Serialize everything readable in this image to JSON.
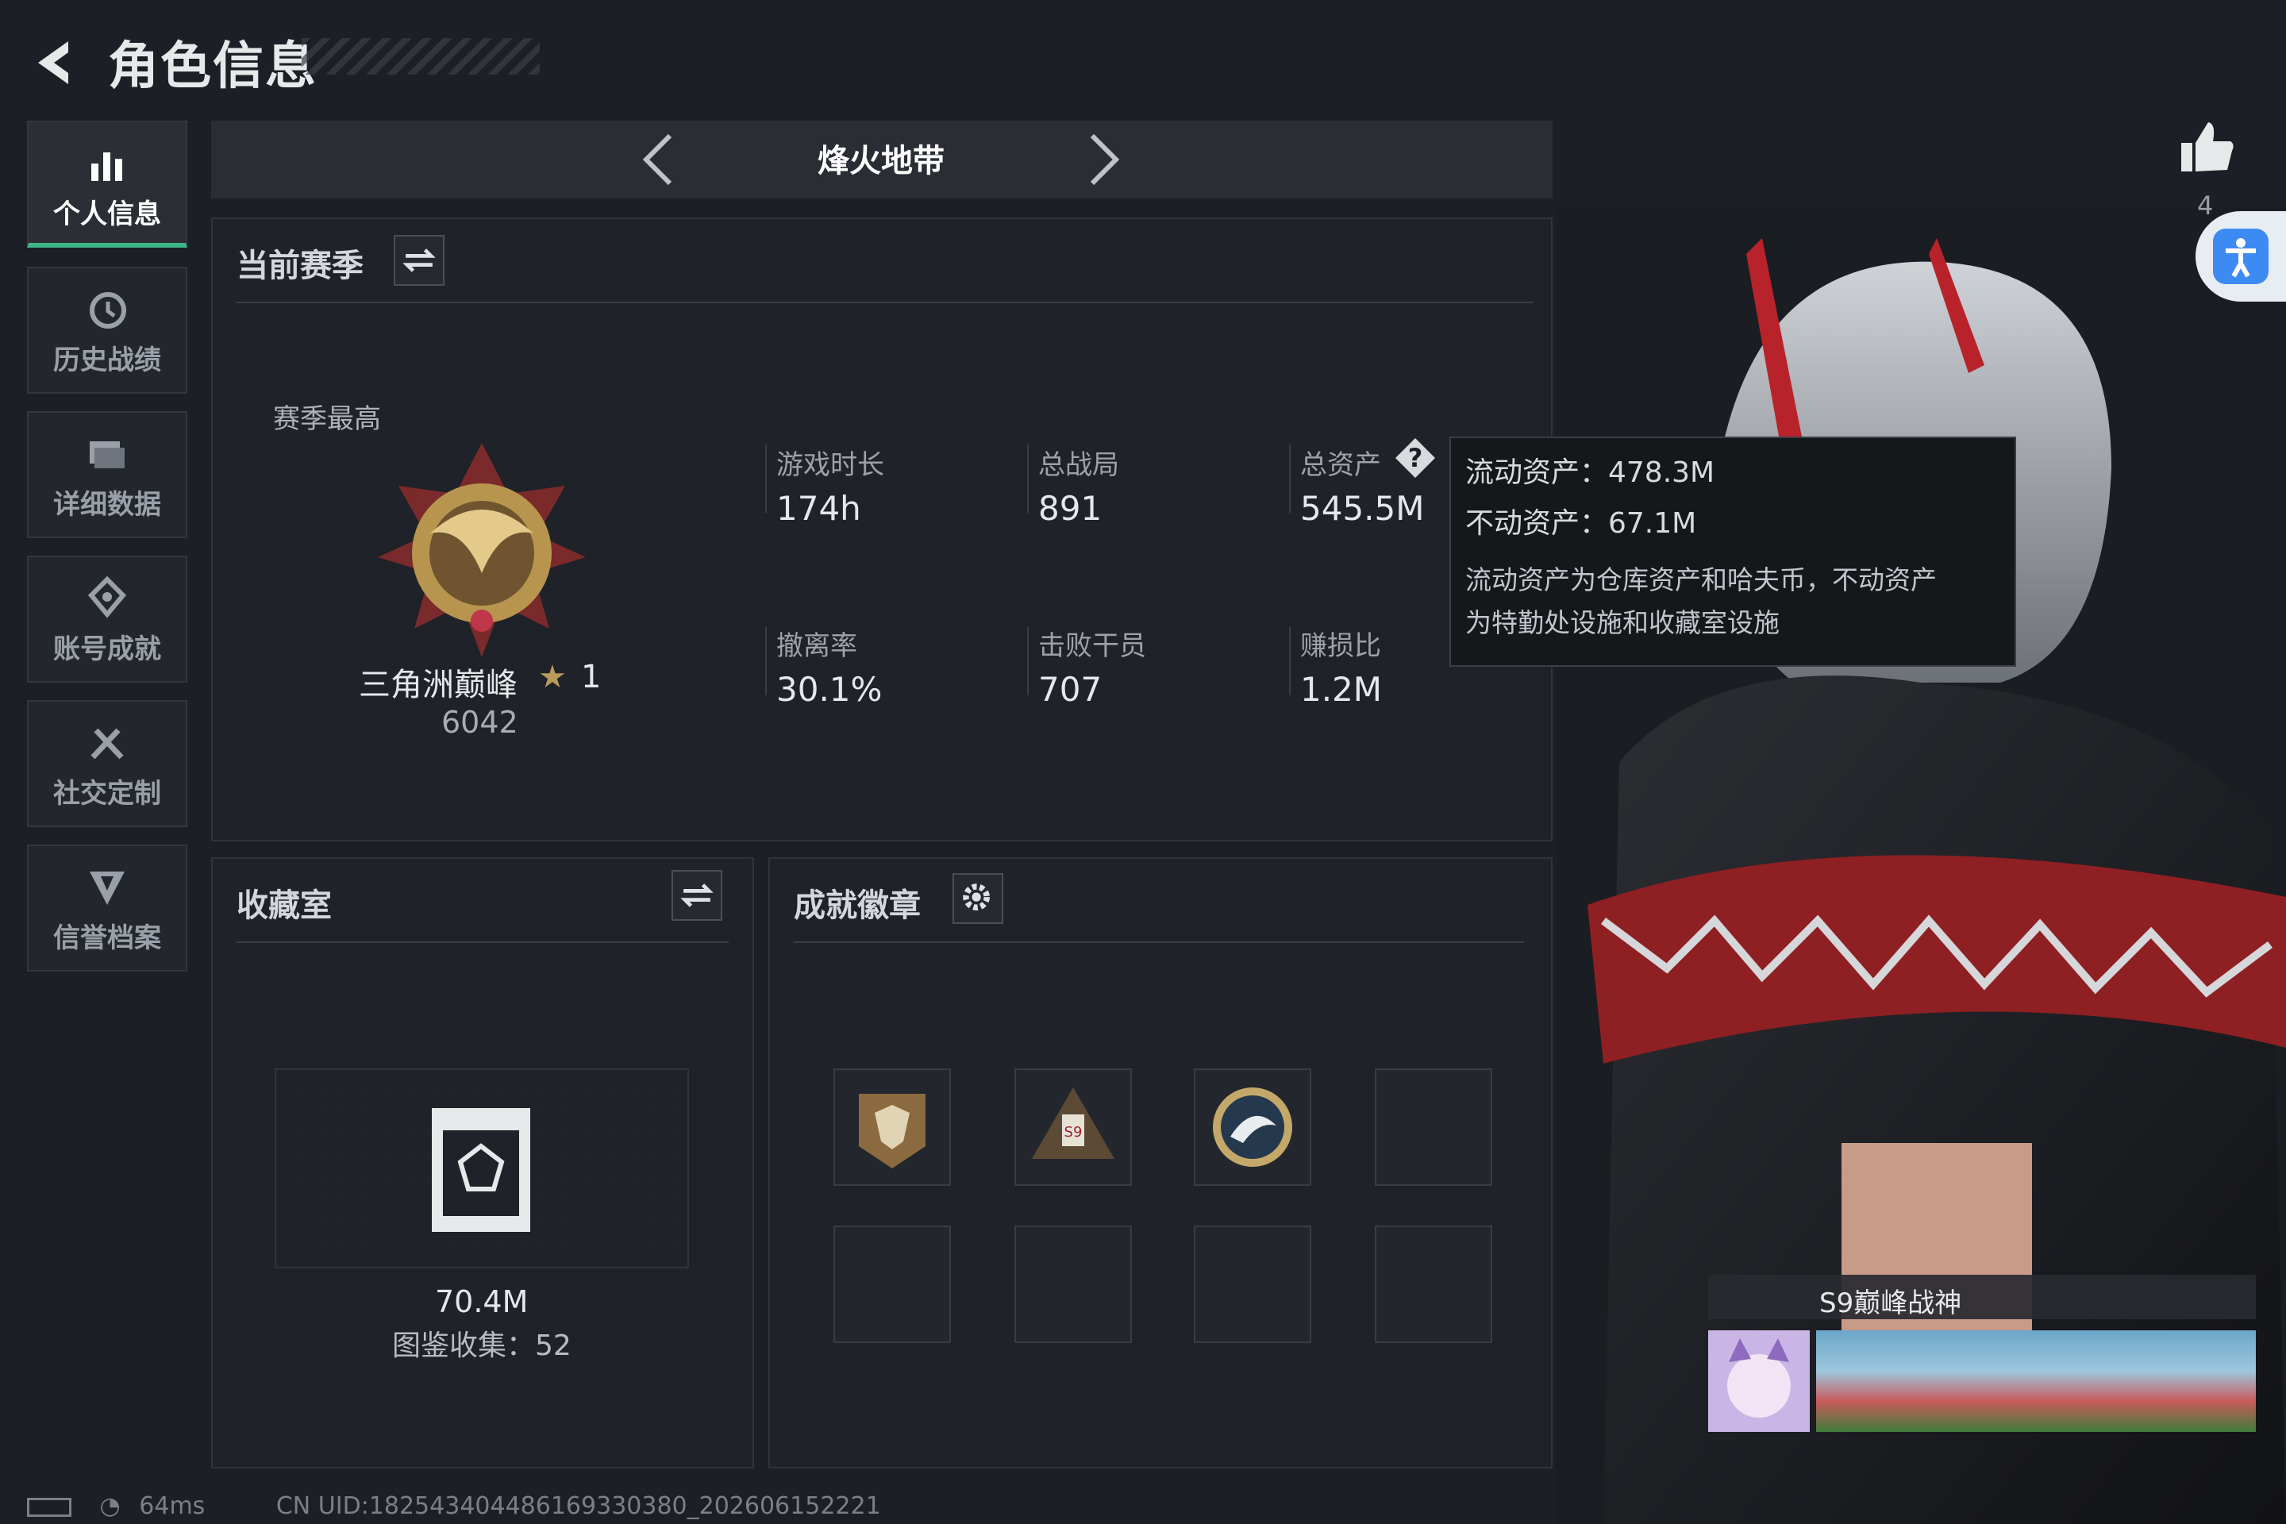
{
  "header": {
    "title": "角色信息"
  },
  "sidebar": {
    "items": [
      {
        "label": "个人信息",
        "icon": "bar-chart-icon",
        "active": true
      },
      {
        "label": "历史战绩",
        "icon": "history-clock-icon"
      },
      {
        "label": "详细数据",
        "icon": "folder-icon"
      },
      {
        "label": "账号成就",
        "icon": "achievement-icon"
      },
      {
        "label": "社交定制",
        "icon": "tools-icon"
      },
      {
        "label": "信誉档案",
        "icon": "shield-icon"
      }
    ]
  },
  "mode": {
    "title": "烽火地带"
  },
  "season": {
    "title": "当前赛季",
    "best_label": "赛季最高",
    "rank_name": "三角洲巅峰",
    "rank_stars": "1",
    "rank_score": "6042",
    "stats": [
      {
        "label": "游戏时长",
        "value": "174h"
      },
      {
        "label": "总战局",
        "value": "891"
      },
      {
        "label": "总资产",
        "value": "545.5M"
      },
      {
        "label": "撤离率",
        "value": "30.1%"
      },
      {
        "label": "击败干员",
        "value": "707"
      },
      {
        "label": "赚损比",
        "value": "1.2M"
      }
    ]
  },
  "tooltip": {
    "liquid": "流动资产：478.3M",
    "fixed": "不动资产：67.1M",
    "note_1": "流动资产为仓库资产和哈夫币，不动资产",
    "note_2": "为特勤处设施和收藏室设施"
  },
  "collection": {
    "title": "收藏室",
    "value": "70.4M",
    "count": "图鉴收集：52"
  },
  "badges": {
    "title": "成就徽章",
    "items": [
      "fox-badge-icon",
      "s9-badge-icon",
      "dolphin-badge-icon",
      "empty",
      "empty",
      "empty",
      "empty",
      "empty"
    ]
  },
  "social": {
    "likes": "4"
  },
  "profile_card": {
    "title": "S9巅峰战神"
  },
  "status_bar": {
    "ping": "64ms",
    "uid": "CN UID:18254340448616933038​0_202606152221"
  },
  "colors": {
    "accent": "#3fb58a",
    "background": "#1c1f25",
    "accessibility": "#3d8bf2"
  }
}
